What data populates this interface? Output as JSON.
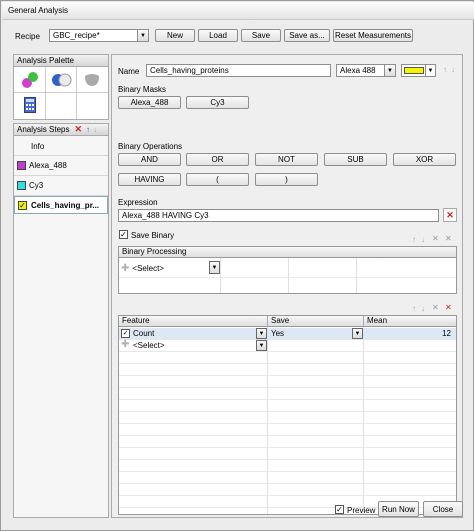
{
  "window": {
    "title": "General Analysis"
  },
  "toolbar": {
    "recipe_label": "Recipe",
    "recipe_value": "GBC_recipe*",
    "new_label": "New",
    "load_label": "Load",
    "save_label": "Save",
    "save_as_label": "Save as...",
    "reset_label": "Reset Measurements"
  },
  "palette": {
    "title": "Analysis Palette"
  },
  "steps": {
    "title": "Analysis Steps",
    "items": [
      {
        "label": "Info",
        "color": ""
      },
      {
        "label": "Alexa_488",
        "color": "#c03ccf"
      },
      {
        "label": "Cy3",
        "color": "#30e0e0"
      },
      {
        "label": "Cells_having_pr...",
        "color": "#f2f200",
        "checked": true,
        "selected": true
      }
    ]
  },
  "editor": {
    "name_label": "Name",
    "name_value": "Cells_having_proteins",
    "channel_value": "Alexa 488",
    "color_value": "#f5f500",
    "binary_masks_label": "Binary Masks",
    "masks": [
      "Alexa_488",
      "Cy3"
    ],
    "binary_ops_label": "Binary Operations",
    "ops": [
      "AND",
      "OR",
      "NOT",
      "SUB",
      "XOR",
      "HAVING",
      "(",
      ")"
    ],
    "expression_label": "Expression",
    "expression_value": "Alexa_488 HAVING Cy3",
    "save_binary_label": "Save Binary",
    "binary_processing_header": "Binary Processing",
    "select_placeholder": "<Select>",
    "features_table": {
      "headers": [
        "Feature",
        "Save",
        "Mean"
      ],
      "rows": [
        {
          "feature": "Count",
          "save": "Yes",
          "mean": "12",
          "checked": true
        },
        {
          "feature": "<Select>",
          "save": "",
          "mean": ""
        }
      ]
    }
  },
  "footer": {
    "preview_label": "Preview",
    "run_now_label": "Run Now",
    "close_label": "Close"
  }
}
